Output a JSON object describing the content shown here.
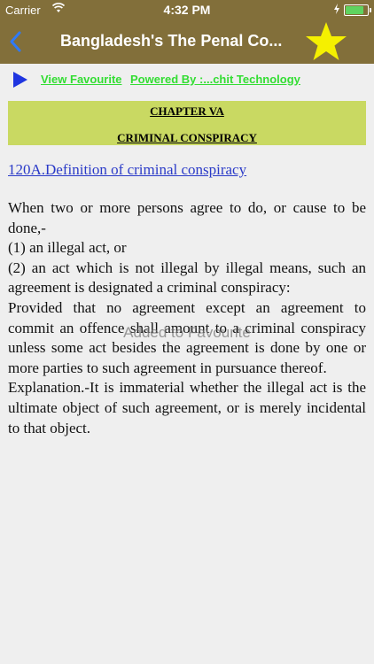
{
  "status_bar": {
    "carrier": "Carrier",
    "time": "4:32 PM"
  },
  "nav": {
    "title": "Bangladesh's The Penal Co...",
    "back_icon": "chevron-left-icon",
    "favourite_icon": "star-icon"
  },
  "toolbar": {
    "play_icon": "play-icon",
    "view_favourite": "View Favourite",
    "powered_by": "Powered By :...chit Technology"
  },
  "chapter": {
    "number": "CHAPTER VA",
    "title": "CRIMINAL CONSPIRACY"
  },
  "section": {
    "heading": "120A.Definition of criminal conspiracy",
    "paragraphs": [
      "When two or more persons agree to do, or cause to be done,-",
      "(1) an illegal act, or",
      "(2) an act which is not illegal by illegal means, such an agreement is designated a criminal conspiracy:",
      "Provided that no agreement except an agreement to commit an offence shall amount to a criminal conspiracy unless some act besides the agreement is done by one or more parties to such agreement in pursuance thereof.",
      "Explanation.-It is immaterial whether the illegal act is the ultimate object of such agreement, or is merely incidental to that object."
    ]
  },
  "toast": "Added to Favourite",
  "colors": {
    "nav_bar": "#826f3a",
    "chapter_box": "#c9d962",
    "link_green": "#33dd33",
    "link_blue": "#2a3ac8",
    "star": "#f5f000",
    "back_arrow": "#2f7af7"
  }
}
